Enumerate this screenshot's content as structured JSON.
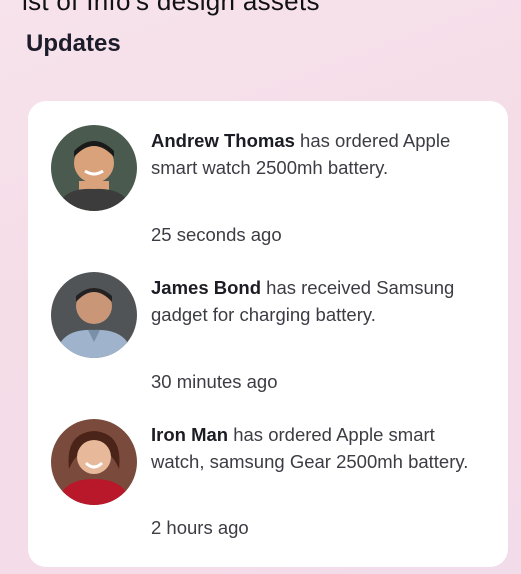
{
  "top_cut_text": "ist of Info's design assets",
  "title": "Updates",
  "updates": [
    {
      "name": "Andrew Thomas",
      "message": " has ordered Apple smart watch 2500mh battery.",
      "time": "25 seconds ago",
      "avatar": "avatar-andrew-thomas"
    },
    {
      "name": "James Bond",
      "message": " has received Samsung gadget for charging battery.",
      "time": "30 minutes ago",
      "avatar": "avatar-james-bond"
    },
    {
      "name": "Iron Man",
      "message": " has ordered Apple smart watch, samsung Gear 2500mh battery.",
      "time": "2 hours ago",
      "avatar": "avatar-iron-man"
    }
  ],
  "colors": {
    "background": "#f5dde8",
    "card": "#ffffff",
    "title": "#1c1c2a",
    "text": "#3c3c44"
  }
}
